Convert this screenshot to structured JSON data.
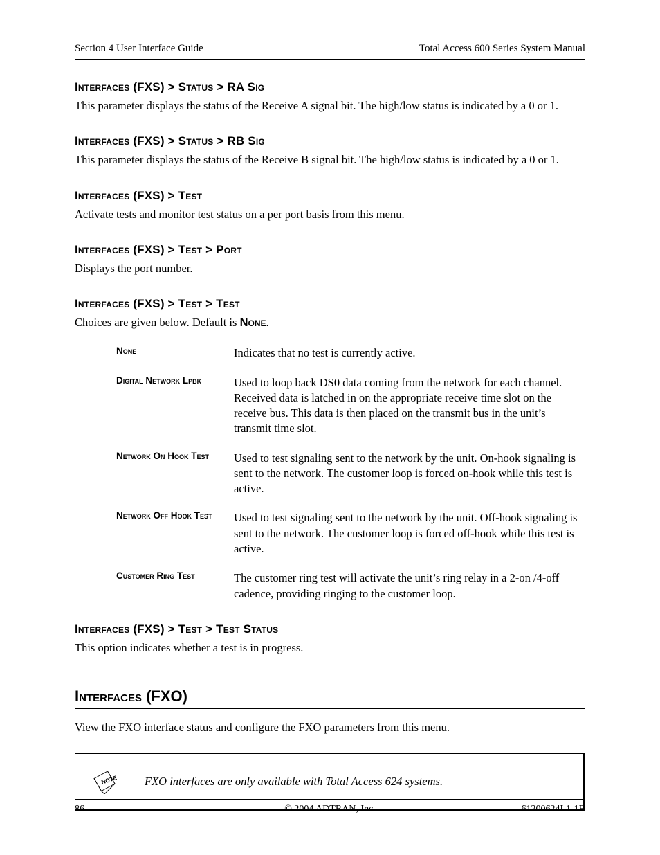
{
  "header": {
    "left": "Section 4  User Interface Guide",
    "right": "Total Access 600 Series System Manual"
  },
  "sections": {
    "ra_sig": {
      "heading": "Interfaces (FXS) > Status > RA Sig",
      "body": "This parameter displays the status of the Receive A signal bit. The high/low status is indicated by a 0 or 1."
    },
    "rb_sig": {
      "heading": "Interfaces (FXS) > Status > RB Sig",
      "body": "This parameter displays the status of the Receive B signal bit. The high/low status is indicated by a 0 or 1."
    },
    "test": {
      "heading": "Interfaces (FXS) > Test",
      "body": "Activate tests and monitor test status on a per port basis from this menu."
    },
    "test_port": {
      "heading": "Interfaces (FXS) > Test > Port",
      "body": "Displays the port number."
    },
    "test_test": {
      "heading": "Interfaces (FXS) > Test > Test",
      "body_pre": "Choices are given below. Default is ",
      "body_bold": "None",
      "body_post": "."
    },
    "test_status": {
      "heading": "Interfaces (FXS) > Test > Test Status",
      "body": "This option indicates whether a test is in progress."
    },
    "fxo": {
      "heading": "Interfaces (FXO)",
      "body": "View the FXO interface status and configure the FXO parameters from this menu."
    }
  },
  "defs": {
    "none": {
      "term": "None",
      "desc": "Indicates that no test is currently active."
    },
    "dnl": {
      "term": "Digital Network Lpbk",
      "desc": "Used to loop back DS0 data coming from the network for each channel. Received data is latched in on the appropriate receive time slot on the receive bus. This data is then placed on the transmit bus in the unit’s transmit time slot."
    },
    "noh": {
      "term": "Network On Hook Test",
      "desc": "Used to test signaling sent to the network by the unit. On-hook signaling is sent to the network. The customer loop is forced on-hook while this test is active."
    },
    "nofh": {
      "term": "Network Off Hook Test",
      "desc": "Used to test signaling sent to the network by the unit. Off-hook signaling is sent to the network. The customer loop is forced off-hook while this test is active."
    },
    "crt": {
      "term": "Customer Ring Test",
      "desc": "The customer ring test will activate the unit’s ring relay in a 2-on /4-off cadence, providing ringing to the customer loop."
    }
  },
  "note": {
    "text": "FXO interfaces are only available with Total Access 624 systems."
  },
  "footer": {
    "left": "86",
    "center": "© 2004 ADTRAN, Inc.",
    "right": "61200624L1-1B"
  }
}
